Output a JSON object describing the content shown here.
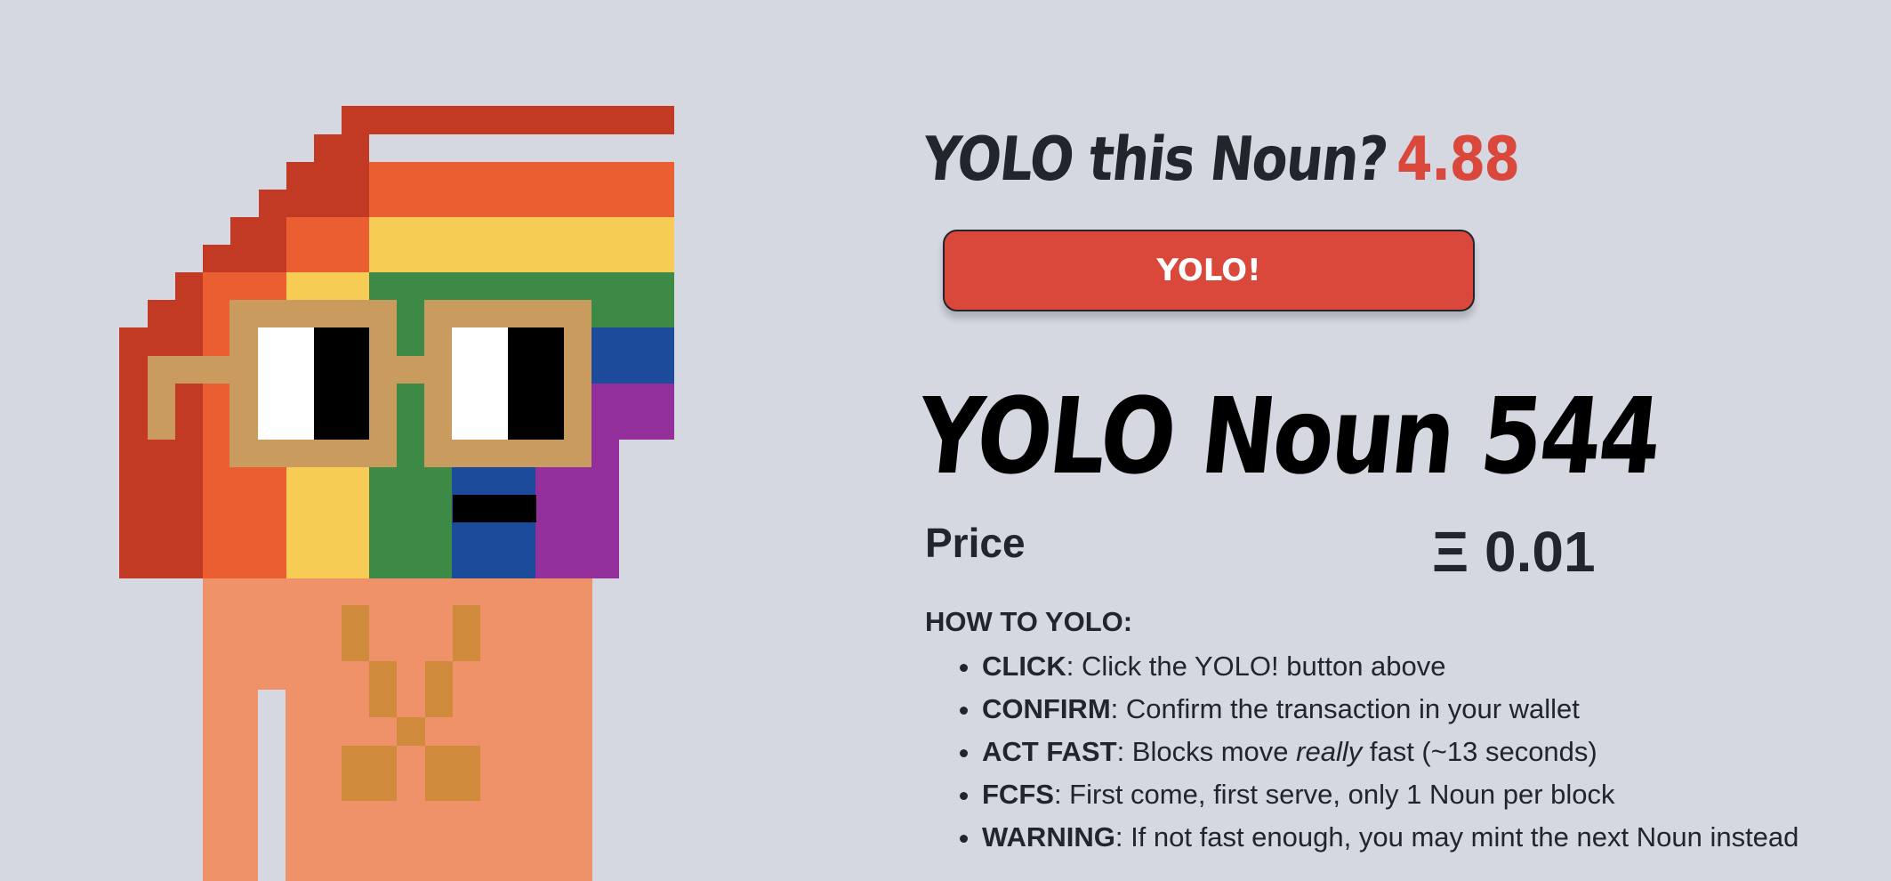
{
  "header": {
    "title": "YOLO this Noun?",
    "countdown": "4.88"
  },
  "actions": {
    "yolo_label": "YOLO!"
  },
  "noun": {
    "heading": "YOLO Noun 544",
    "price_label": "Price",
    "price_value": "Ξ 0.01"
  },
  "instructions": {
    "title": "HOW TO YOLO:",
    "items": [
      {
        "term": "CLICK",
        "sep": ": ",
        "text": "Click the YOLO! button above"
      },
      {
        "term": "CONFIRM",
        "sep": ": ",
        "text": "Confirm the transaction in your wallet"
      },
      {
        "term": "ACT FAST",
        "sep": ": ",
        "pre": "Blocks move ",
        "em": "really",
        "post": " fast (~13 seconds)"
      },
      {
        "term": "FCFS",
        "sep": ": ",
        "text": "First come, first serve, only 1 Noun per block"
      },
      {
        "term": "WARNING",
        "sep": ": ",
        "text": "If not fast enough, you may mint the next Noun instead"
      }
    ]
  },
  "colors": {
    "background": "#d5d7e1",
    "accent_red": "#d9483b",
    "text_dark": "#22252b",
    "rainbow_red": "#c23a24",
    "rainbow_orange": "#eb5e31",
    "rainbow_yellow": "#f6cc54",
    "rainbow_green": "#3d8946",
    "rainbow_blue": "#1d4b9b",
    "rainbow_purple": "#93309b",
    "glasses_frame": "#c99b5e",
    "body_peach": "#ef926a",
    "accessory_brown": "#d08a3c"
  }
}
